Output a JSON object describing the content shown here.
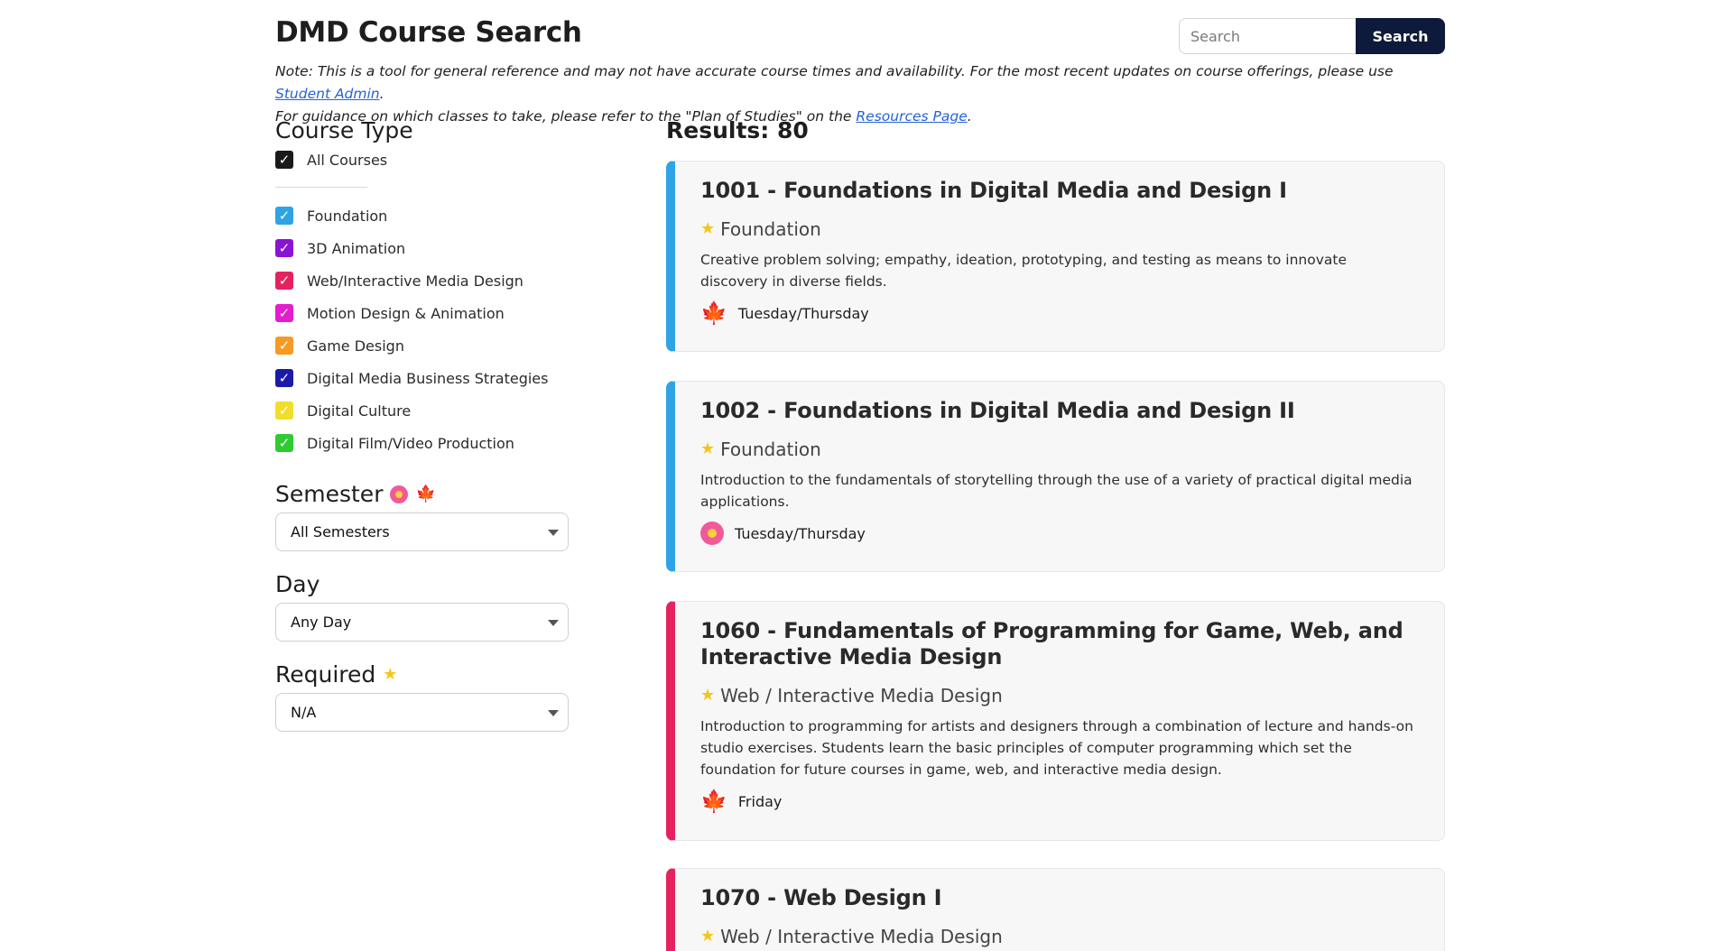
{
  "header": {
    "title": "DMD Course Search",
    "search_placeholder": "Search",
    "search_button": "Search"
  },
  "note": {
    "line1_prefix": "Note: This is a tool for general reference and may not have accurate course times and availability. For the most recent updates on course offerings, please use ",
    "line1_link": "Student Admin",
    "line1_suffix": ".",
    "line2_prefix": "For guidance on which classes to take, please refer to the \"Plan of Studies\" on the ",
    "line2_link": "Resources Page",
    "line2_suffix": "."
  },
  "sidebar": {
    "course_type_heading": "Course Type",
    "all_courses": {
      "label": "All Courses",
      "color": "#1a1a1a",
      "checked": true
    },
    "types": [
      {
        "label": "Foundation",
        "color": "#2fa3e6"
      },
      {
        "label": "3D Animation",
        "color": "#8a13d6"
      },
      {
        "label": "Web/Interactive Media Design",
        "color": "#e6225e"
      },
      {
        "label": "Motion Design & Animation",
        "color": "#e51ccf"
      },
      {
        "label": "Game Design",
        "color": "#f59a23"
      },
      {
        "label": "Digital Media Business Strategies",
        "color": "#1c1aa8"
      },
      {
        "label": "Digital Culture",
        "color": "#f3dd2b"
      },
      {
        "label": "Digital Film/Video Production",
        "color": "#2ecc32"
      }
    ],
    "semester_heading": "Semester",
    "semester_icons": [
      "flower-icon",
      "leaf-icon"
    ],
    "semester_value": "All Semesters",
    "day_heading": "Day",
    "day_value": "Any Day",
    "required_heading": "Required",
    "required_icon": "star-icon",
    "required_value": "N/A"
  },
  "results": {
    "label": "Results: 80",
    "courses": [
      {
        "title": "1001 - Foundations in Digital Media and Design I",
        "type": "Foundation",
        "accent": "#2fa3e6",
        "description": "Creative problem solving; empathy, ideation, prototyping, and testing as means to innovate discovery in diverse fields.",
        "semester_icon": "leaf-icon",
        "days": "Tuesday/Thursday"
      },
      {
        "title": "1002 - Foundations in Digital Media and Design II",
        "type": "Foundation",
        "accent": "#2fa3e6",
        "description": "Introduction to the fundamentals of storytelling through the use of a variety of practical digital media applications.",
        "semester_icon": "flower-icon",
        "days": "Tuesday/Thursday"
      },
      {
        "title": "1060 - Fundamentals of Programming for Game, Web, and Interactive Media Design",
        "type": "Web / Interactive Media Design",
        "accent": "#e6225e",
        "description": "Introduction to programming for artists and designers through a combination of lecture and hands-on studio exercises. Students learn the basic principles of computer programming which set the foundation for future courses in game, web, and interactive media design.",
        "semester_icon": "leaf-icon",
        "days": "Friday"
      },
      {
        "title": "1070 - Web Design I",
        "type": "Web / Interactive Media Design",
        "accent": "#e6225e"
      }
    ]
  }
}
